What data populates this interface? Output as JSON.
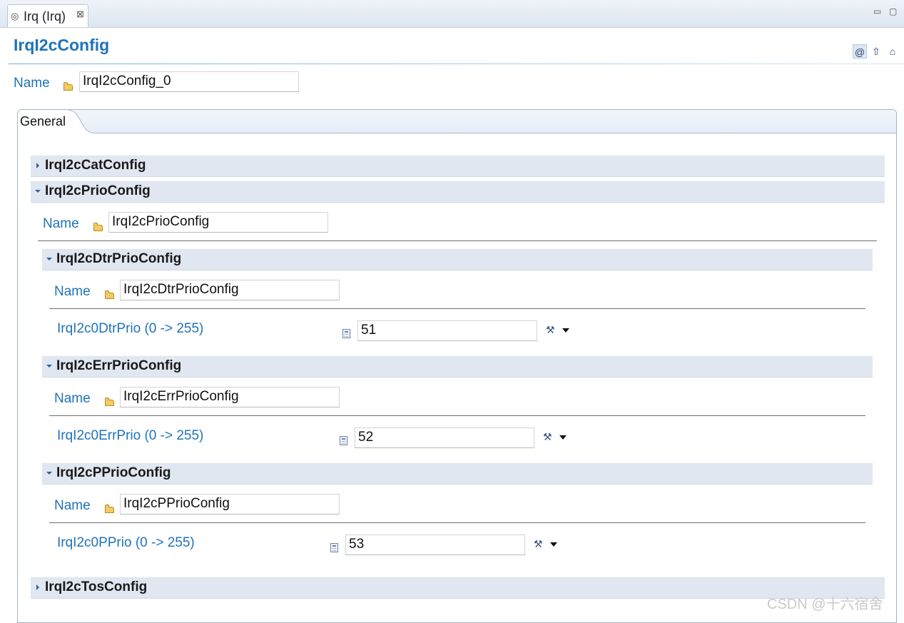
{
  "editor_tab": {
    "title": "Irq (Irq)",
    "close_glyph": "⊠"
  },
  "window_controls": {
    "minimize": "▭",
    "maximize": "▢"
  },
  "page": {
    "title": "IrqI2cConfig"
  },
  "toolbar": {
    "at_icon": "@",
    "up_icon": "⇧",
    "home_icon": "⌂"
  },
  "name_field": {
    "label": "Name",
    "value": "IrqI2cConfig_0"
  },
  "tabs": {
    "general": "General"
  },
  "sections": {
    "cat": {
      "title": "IrqI2cCatConfig",
      "expanded": false
    },
    "prio": {
      "title": "IrqI2cPrioConfig",
      "expanded": true,
      "name_label": "Name",
      "name_value": "IrqI2cPrioConfig",
      "dtr": {
        "title": "IrqI2cDtrPrioConfig",
        "name_label": "Name",
        "name_value": "IrqI2cDtrPrioConfig",
        "param_label": "IrqI2c0DtrPrio (0 -> 255)",
        "param_value": "51"
      },
      "err": {
        "title": "IrqI2cErrPrioConfig",
        "name_label": "Name",
        "name_value": "IrqI2cErrPrioConfig",
        "param_label": "IrqI2c0ErrPrio (0 -> 255)",
        "param_value": "52"
      },
      "p": {
        "title": "IrqI2cPPrioConfig",
        "name_label": "Name",
        "name_value": "IrqI2cPPrioConfig",
        "param_label": "IrqI2c0PPrio (0 -> 255)",
        "param_value": "53"
      }
    },
    "tos": {
      "title": "IrqI2cTosConfig",
      "expanded": false
    }
  },
  "watermark": "CSDN @十六宿舍",
  "colors": {
    "label_blue": "#1f73b8",
    "section_bg": "#e1e7f0"
  }
}
